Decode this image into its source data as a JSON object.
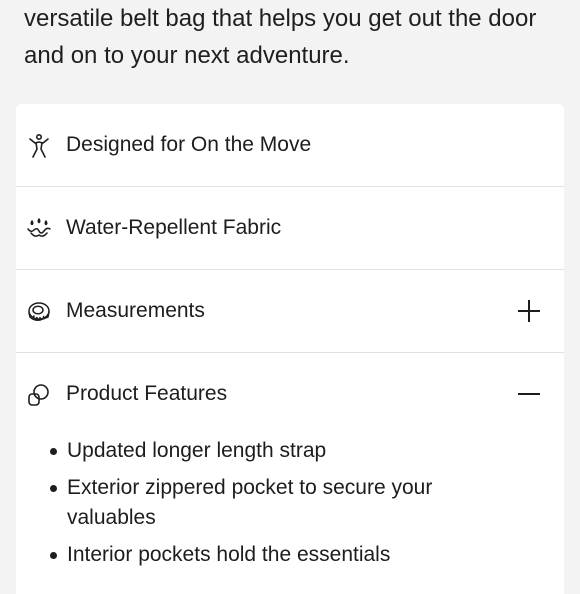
{
  "intro_text": "versatile belt bag that helps you get out the door and on to your next adventure.",
  "accordion": [
    {
      "label": "Designed for On the Move",
      "icon": "person-stretch-icon",
      "toggle": "none"
    },
    {
      "label": "Water-Repellent Fabric",
      "icon": "water-drops-icon",
      "toggle": "none"
    },
    {
      "label": "Measurements",
      "icon": "measuring-tape-icon",
      "toggle": "plus"
    },
    {
      "label": "Product Features",
      "icon": "shapes-icon",
      "toggle": "minus"
    }
  ],
  "product_features": [
    "Updated longer length strap",
    "Exterior zippered pocket to secure your valuables",
    "Interior pockets hold the essentials"
  ],
  "colors": {
    "background": "#f3f3f3",
    "card": "#ffffff",
    "text": "#1d1d1d",
    "divider": "#e2e2e2"
  }
}
